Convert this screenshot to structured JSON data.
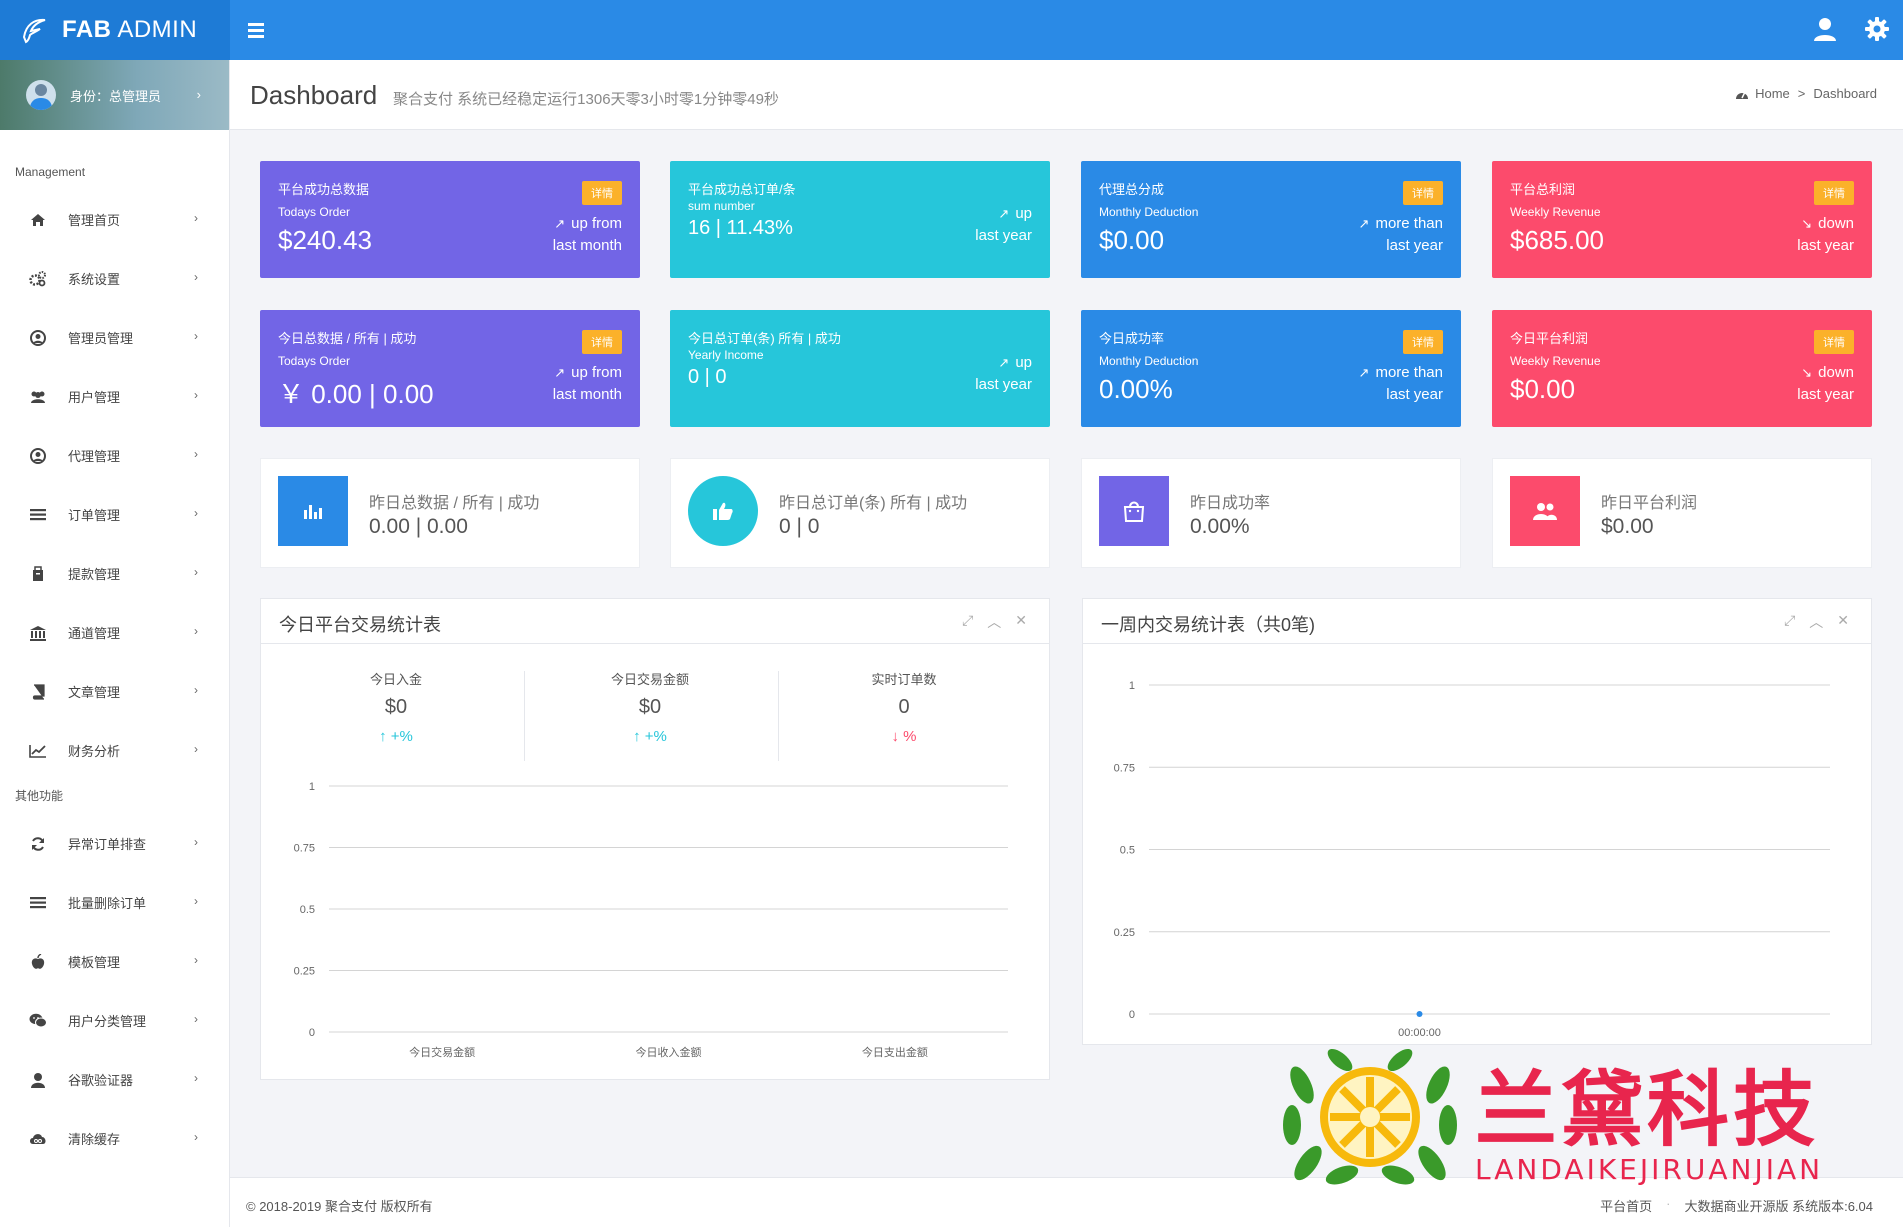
{
  "header": {
    "brand_bold": "FAB",
    "brand_rest": " ADMIN"
  },
  "sidebar": {
    "profile_label": "身份：总管理员",
    "section_management": "Management",
    "section_other": "其他功能",
    "items": [
      {
        "label": "管理首页",
        "icon": "home-icon"
      },
      {
        "label": "系统设置",
        "icon": "gears-icon"
      },
      {
        "label": "管理员管理",
        "icon": "user-circle-icon"
      },
      {
        "label": "用户管理",
        "icon": "users-icon"
      },
      {
        "label": "代理管理",
        "icon": "user-circle-icon"
      },
      {
        "label": "订单管理",
        "icon": "list-icon"
      },
      {
        "label": "提款管理",
        "icon": "briefcase-icon"
      },
      {
        "label": "通道管理",
        "icon": "bank-icon"
      },
      {
        "label": "文章管理",
        "icon": "book-icon"
      },
      {
        "label": "财务分析",
        "icon": "line-chart-icon"
      }
    ],
    "other_items": [
      {
        "label": "异常订单排查",
        "icon": "refresh-icon"
      },
      {
        "label": "批量删除订单",
        "icon": "list-icon"
      },
      {
        "label": "模板管理",
        "icon": "apple-icon"
      },
      {
        "label": "用户分类管理",
        "icon": "wechat-icon"
      },
      {
        "label": "谷歌验证器",
        "icon": "user-icon"
      },
      {
        "label": "清除缓存",
        "icon": "cloud-icon"
      }
    ]
  },
  "page": {
    "title": "Dashboard",
    "subtitle": "聚合支付 系统已经稳定运行1306天零3小时零1分钟零49秒",
    "breadcrumb_home": "Home",
    "breadcrumb_sep": ">",
    "breadcrumb_current": "Dashboard"
  },
  "cards_row1": [
    {
      "title": "平台成功总数据",
      "sub": "Todays Order",
      "value": "$240.43",
      "badge": "详情",
      "trend1": "up from",
      "trend2": "last month",
      "arrow": "↗"
    },
    {
      "title": "平台成功总订单/条",
      "sub": "sum number",
      "value": "16 | 11.43%",
      "trend1": "up",
      "trend2": "last year",
      "arrow": "↗"
    },
    {
      "title": "代理总分成",
      "sub": "Monthly Deduction",
      "value": "$0.00",
      "badge": "详情",
      "trend1": "more than",
      "trend2": "last year",
      "arrow": "↗"
    },
    {
      "title": "平台总利润",
      "sub": "Weekly Revenue",
      "value": "$685.00",
      "badge": "详情",
      "trend1": "down",
      "trend2": "last year",
      "arrow": "↘"
    }
  ],
  "cards_row2": [
    {
      "title": "今日总数据 / 所有 | 成功",
      "sub": "Todays Order",
      "value": "￥ 0.00 | 0.00",
      "badge": "详情",
      "trend1": "up from",
      "trend2": "last month",
      "arrow": "↗"
    },
    {
      "title": "今日总订单(条) 所有 | 成功",
      "sub": "Yearly Income",
      "value": "0  | 0",
      "trend1": "up",
      "trend2": "last year",
      "arrow": "↗"
    },
    {
      "title": "今日成功率",
      "sub": "Monthly Deduction",
      "value": "0.00%",
      "badge": "详情",
      "trend1": "more than",
      "trend2": "last year",
      "arrow": "↗"
    },
    {
      "title": "今日平台利润",
      "sub": "Weekly Revenue",
      "value": "$0.00",
      "badge": "详情",
      "trend1": "down",
      "trend2": "last year",
      "arrow": "↘"
    }
  ],
  "info_cards": [
    {
      "title": "昨日总数据 / 所有 | 成功",
      "value": "0.00 | 0.00",
      "icon": "bar-chart-icon",
      "color": "#2a8ae6"
    },
    {
      "title": "昨日总订单(条) 所有 | 成功",
      "value": "0  | 0",
      "icon": "thumbs-up-icon",
      "color": "#26c6da"
    },
    {
      "title": "昨日成功率",
      "value": "0.00%",
      "icon": "shopping-bag-icon",
      "color": "#7265e6"
    },
    {
      "title": "昨日平台利润",
      "value": "$0.00",
      "icon": "users-icon",
      "color": "#fc4b6c"
    }
  ],
  "panel_today": {
    "title": "今日平台交易统计表",
    "summary": [
      {
        "label": "今日入金",
        "value": "$0",
        "change": "+%",
        "direction": "up",
        "color": "#26c6da"
      },
      {
        "label": "今日交易金额",
        "value": "$0",
        "change": "+%",
        "direction": "up",
        "color": "#26c6da"
      },
      {
        "label": "实时订单数",
        "value": "0",
        "change": "%",
        "direction": "down",
        "color": "#fc4b6c"
      }
    ]
  },
  "panel_week": {
    "title": "一周内交易统计表（共0笔)"
  },
  "chart_data": [
    {
      "type": "bar",
      "categories": [
        "今日交易金额",
        "今日收入金额",
        "今日支出金额"
      ],
      "values": [
        0,
        0,
        0
      ],
      "ylim": [
        0,
        1
      ],
      "yticks": [
        "0",
        "0.25",
        "0.5",
        "0.75",
        "1"
      ],
      "grid": true
    },
    {
      "type": "line",
      "x": [
        "00:00:00"
      ],
      "values": [
        0
      ],
      "ylim": [
        0,
        1
      ],
      "yticks": [
        "0",
        "0.25",
        "0.5",
        "0.75",
        "1"
      ],
      "grid": true,
      "point_color": "#2a8ae6"
    }
  ],
  "footer": {
    "copyright": "© 2018-2019 聚合支付 版权所有",
    "link_home": "平台首页",
    "dot": "·",
    "version": "大数据商业开源版 系统版本:6.04"
  },
  "watermark": {
    "text": "兰黛科技",
    "sub": "LANDAIKEJIRUANJIAN"
  },
  "colors": {
    "topbar": "#2a8ae6",
    "purple": "#7265e6",
    "cyan": "#26c6da",
    "blue": "#2a8ae6",
    "red": "#fc4b6c",
    "badge": "#fbb12a"
  }
}
